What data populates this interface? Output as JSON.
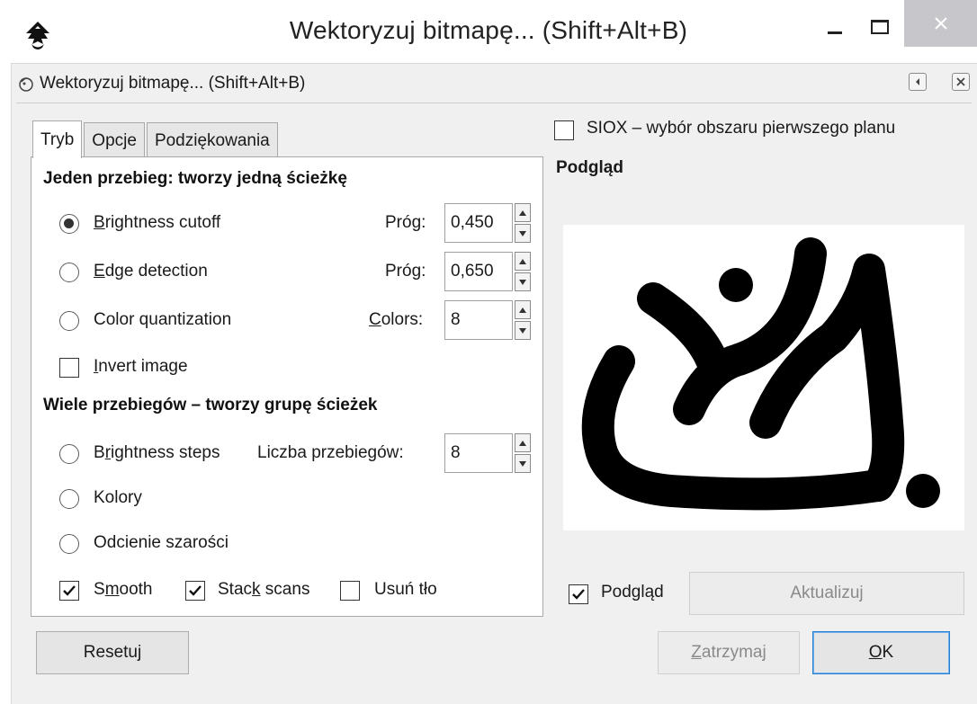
{
  "window": {
    "title": "Wektoryzuj bitmapę... (Shift+Alt+B)",
    "controls": {
      "minimize_icon": "minimize-icon",
      "maximize_icon": "maximize-icon",
      "close_icon": "close-icon"
    },
    "close_hover_color": "#c7c7cb"
  },
  "dock": {
    "title": "Wektoryzuj bitmapę... (Shift+Alt+B)",
    "icons": [
      "dock-trace-icon",
      "dock-iconify-icon",
      "dock-close-icon"
    ]
  },
  "tabs": [
    {
      "label": "Tryb",
      "active": true
    },
    {
      "label": "Opcje",
      "active": false
    },
    {
      "label": "Podziękowania",
      "active": false
    }
  ],
  "mode": {
    "single_title": "Jeden przebieg: tworzy jedną ścieżkę",
    "brightness": {
      "label": "Brightness cutoff",
      "mnemonic": "B",
      "rest": "rightness cutoff",
      "selected": true,
      "param_label": "Próg:",
      "value": "0,450"
    },
    "edge": {
      "label": "Edge detection",
      "mnemonic": "E",
      "rest": "dge detection",
      "selected": false,
      "param_label": "Próg:",
      "value": "0,650"
    },
    "color": {
      "label": "Color quantization",
      "selected": false,
      "param_label": "Colors:",
      "param_mnemonic": "C",
      "param_rest": "olors:",
      "value": "8"
    },
    "invert": {
      "label": "Invert image",
      "mnemonic": "I",
      "rest": "nvert image",
      "checked": false
    },
    "multi_title": "Wiele przebiegów – tworzy grupę ścieżek",
    "steps": {
      "label": "Brightness steps",
      "pre": "B",
      "mnemonic": "r",
      "rest": "ightness steps",
      "selected": false,
      "param_label": "Liczba przebiegów:",
      "value": "8"
    },
    "kolory": {
      "label": "Kolory",
      "selected": false
    },
    "gray": {
      "label": "Odcienie szarości",
      "selected": false
    },
    "smooth": {
      "label": "Smooth",
      "pre": "S",
      "mnemonic": "m",
      "rest": "ooth",
      "checked": true
    },
    "stack": {
      "label": "Stack scans",
      "pre": "Stac",
      "mnemonic": "k",
      "rest": " scans",
      "checked": true
    },
    "remove_bg": {
      "label": "Usuń tło",
      "checked": false
    }
  },
  "siox": {
    "label": "SIOX – wybór obszaru pierwszego planu",
    "checked": false
  },
  "preview": {
    "title": "Podgląd",
    "live_label": "Podgląd",
    "live_checked": true,
    "update_label": "Aktualizuj",
    "image_icon": "traced-shape-preview"
  },
  "buttons": {
    "reset": "Resetuj",
    "stop": {
      "mnemonic": "Z",
      "rest": "atrzymaj"
    },
    "ok": {
      "mnemonic": "O",
      "rest": "K"
    }
  },
  "colors": {
    "accent": "#2b7fd1",
    "panel_bg": "#f0f0f0",
    "tab_border": "#a9a9a9"
  }
}
